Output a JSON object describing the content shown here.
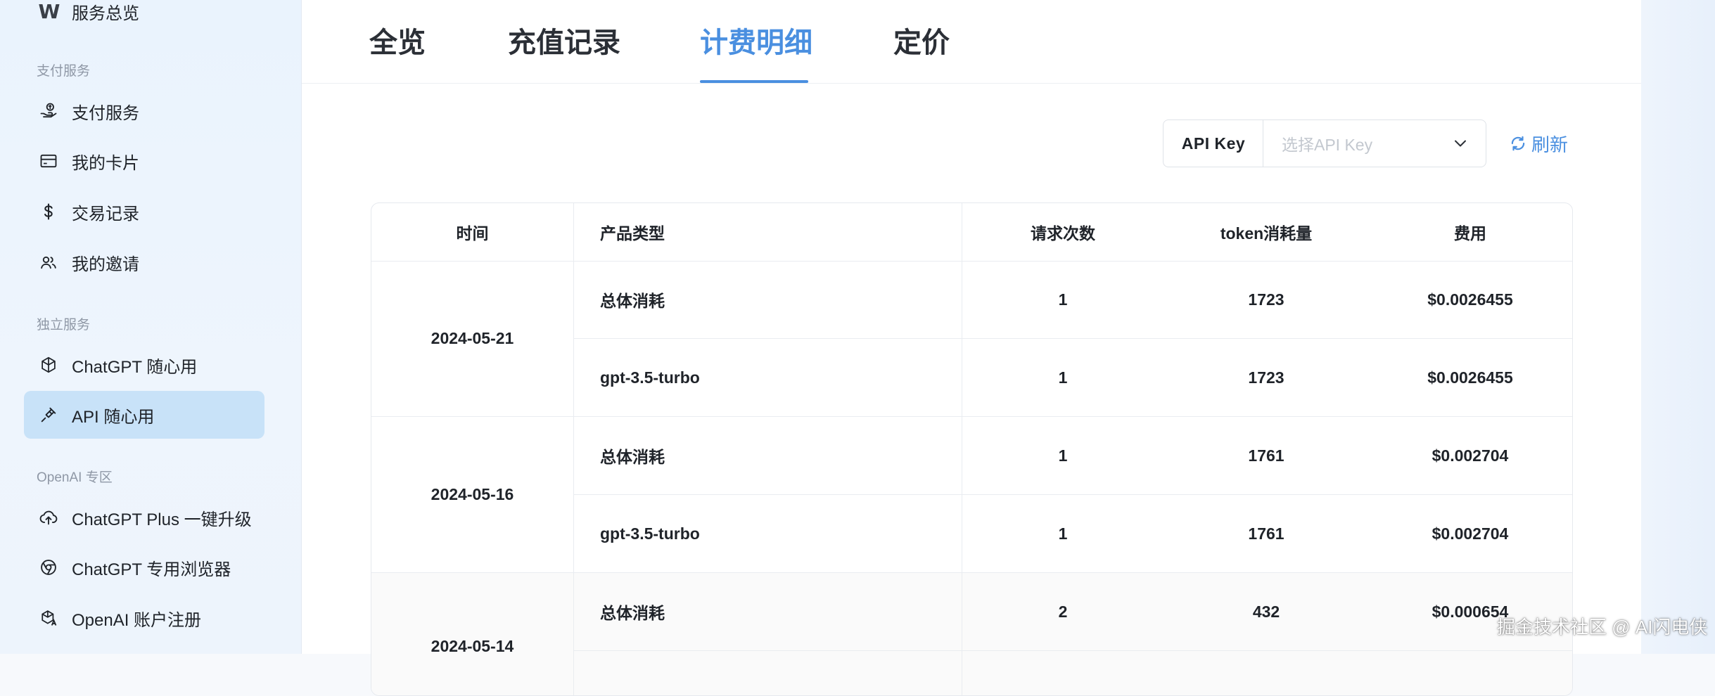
{
  "sidebar": {
    "top_item": {
      "logo": "W",
      "label": "服务总览"
    },
    "sections": [
      {
        "title": "支付服务",
        "items": [
          {
            "label": "支付服务",
            "icon": "hand-coin-icon"
          },
          {
            "label": "我的卡片",
            "icon": "credit-card-icon"
          },
          {
            "label": "交易记录",
            "icon": "dollar-icon"
          },
          {
            "label": "我的邀请",
            "icon": "users-icon"
          }
        ]
      },
      {
        "title": "独立服务",
        "items": [
          {
            "label": "ChatGPT 随心用",
            "icon": "openai-icon"
          },
          {
            "label": "API 随心用",
            "icon": "plug-icon",
            "active": true
          }
        ]
      },
      {
        "title": "OpenAI 专区",
        "items": [
          {
            "label": "ChatGPT Plus 一键升级",
            "icon": "cloud-upload-icon"
          },
          {
            "label": "ChatGPT 专用浏览器",
            "icon": "browser-icon"
          },
          {
            "label": "OpenAI 账户注册",
            "icon": "openai-account-icon"
          }
        ]
      }
    ]
  },
  "tabs": [
    {
      "label": "全览"
    },
    {
      "label": "充值记录"
    },
    {
      "label": "计费明细",
      "active": true
    },
    {
      "label": "定价"
    }
  ],
  "toolbar": {
    "key_label": "API Key",
    "key_placeholder": "选择API Key",
    "refresh_label": "刷新"
  },
  "table": {
    "columns": [
      "时间",
      "产品类型",
      "请求次数",
      "token消耗量",
      "费用"
    ],
    "groups": [
      {
        "date": "2024-05-21",
        "rows": [
          {
            "product": "总体消耗",
            "requests": "1",
            "tokens": "1723",
            "cost": "$0.0026455"
          },
          {
            "product": "gpt-3.5-turbo",
            "requests": "1",
            "tokens": "1723",
            "cost": "$0.0026455"
          }
        ]
      },
      {
        "date": "2024-05-16",
        "rows": [
          {
            "product": "总体消耗",
            "requests": "1",
            "tokens": "1761",
            "cost": "$0.002704"
          },
          {
            "product": "gpt-3.5-turbo",
            "requests": "1",
            "tokens": "1761",
            "cost": "$0.002704"
          }
        ]
      },
      {
        "date": "2024-05-14",
        "rows": [
          {
            "product": "总体消耗",
            "requests": "2",
            "tokens": "432",
            "cost": "$0.000654"
          }
        ]
      }
    ]
  },
  "watermark": "掘金技术社区 @ AI闪电侠",
  "colors": {
    "accent": "#4a8fe0",
    "active_item_bg": "#c8e2f8"
  }
}
